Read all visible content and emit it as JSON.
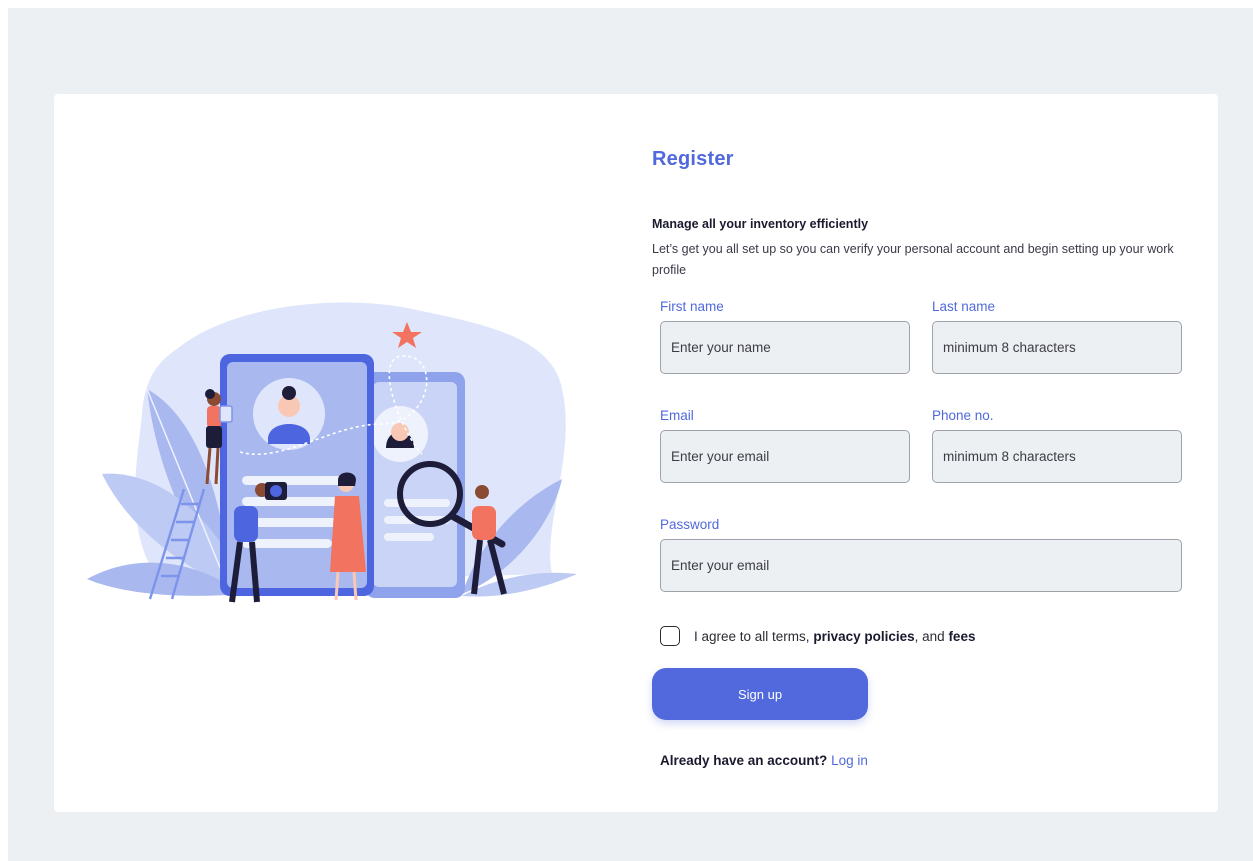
{
  "form": {
    "title": "Register",
    "subtitle": "Manage all your inventory efficiently",
    "description": "Let’s get you all set up so you can verify your personal account and begin setting up your work profile",
    "first_name": {
      "label": "First name",
      "placeholder": "Enter your name"
    },
    "last_name": {
      "label": "Last name",
      "placeholder": "minimum 8 characters"
    },
    "email": {
      "label": "Email",
      "placeholder": "Enter your email"
    },
    "phone": {
      "label": "Phone no.",
      "placeholder": "minimum 8 characters"
    },
    "password": {
      "label": "Password",
      "placeholder": "Enter your email"
    },
    "agree": {
      "prefix": "I agree to all terms,",
      "privacy": "privacy policies",
      "middle": ", and",
      "fees": "fees"
    },
    "signup_label": "Sign up",
    "login_prompt": "Already have an account?",
    "login_link": "Log in"
  },
  "colors": {
    "accent": "#5169dc",
    "page_background": "#edf0f3",
    "illustration_light": "#dfe6fb",
    "illustration_mid": "#a9b9f0",
    "illustration_coral": "#f2735f"
  },
  "icons": [
    "register-illustration",
    "star-icon",
    "magnifier-icon",
    "camera-icon",
    "ladder-icon",
    "leaf-icon"
  ]
}
